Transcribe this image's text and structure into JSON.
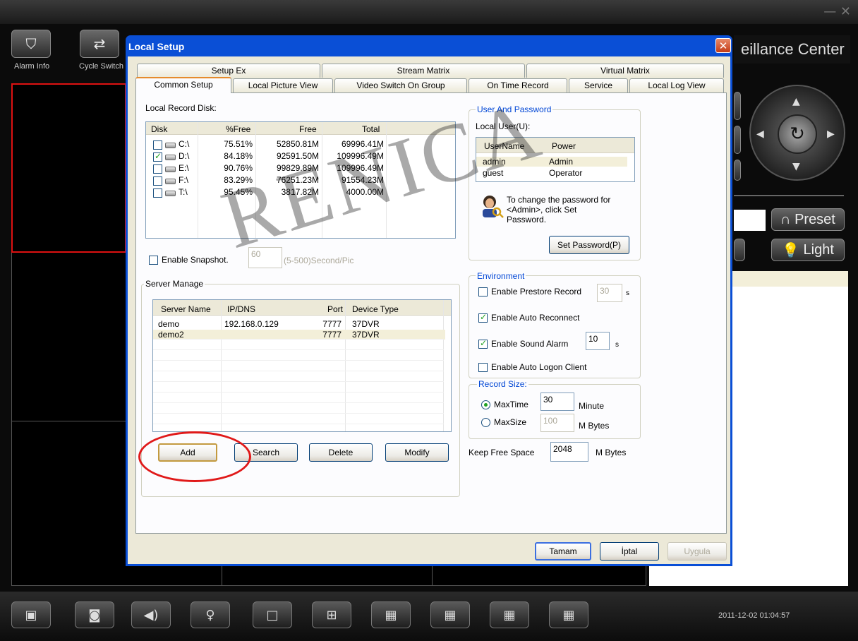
{
  "app": {
    "brand": "eillance Center",
    "window_controls": "— ✕",
    "toolbar": {
      "alarm_info": "Alarm Info",
      "cycle_switch": "Cycle Switch"
    },
    "ptz": {
      "preset_label": "Preset",
      "light_label": "Light"
    },
    "clock": "2011-12-02 01:04:57"
  },
  "dialog": {
    "title": "Local Setup",
    "tabs_row1": [
      "Setup Ex",
      "Stream Matrix",
      "Virtual Matrix"
    ],
    "tabs_row2": [
      "Common Setup",
      "Local Picture View",
      "Video Switch On Group",
      "On Time Record",
      "Service",
      "Local Log View"
    ],
    "local_record_disk": {
      "label": "Local Record Disk:",
      "columns": [
        "Disk",
        "%Free",
        "Free",
        "Total"
      ],
      "rows": [
        {
          "checked": false,
          "disk": "C:\\",
          "pfree": "75.51%",
          "free": "52850.81M",
          "total": "69996.41M"
        },
        {
          "checked": true,
          "disk": "D:\\",
          "pfree": "84.18%",
          "free": "92591.50M",
          "total": "109996.49M"
        },
        {
          "checked": false,
          "disk": "E:\\",
          "pfree": "90.76%",
          "free": "99829.89M",
          "total": "109996.49M"
        },
        {
          "checked": false,
          "disk": "F:\\",
          "pfree": "83.29%",
          "free": "76251.23M",
          "total": "91554.23M"
        },
        {
          "checked": false,
          "disk": "T:\\",
          "pfree": "95.45%",
          "free": "3817.82M",
          "total": "4000.00M"
        }
      ]
    },
    "snapshot": {
      "label": "Enable Snapshot.",
      "value": "60",
      "hint": "(5-500)Second/Pic"
    },
    "server_manage": {
      "legend": "Server Manage",
      "columns": [
        "Server Name",
        "IP/DNS",
        "Port",
        "Device Type"
      ],
      "rows": [
        {
          "name": "demo",
          "ip": "192.168.0.129",
          "port": "7777",
          "type": "37DVR"
        },
        {
          "name": "demo2",
          "ip": "",
          "port": "7777",
          "type": "37DVR"
        }
      ],
      "buttons": {
        "add": "Add",
        "search": "Search",
        "delete": "Delete",
        "modify": "Modify"
      }
    },
    "user_password": {
      "legend": "User And Password",
      "local_user": "Local User(U):",
      "columns": [
        "UserName",
        "Power"
      ],
      "rows": [
        {
          "name": "admin",
          "power": "Admin"
        },
        {
          "name": "guest",
          "power": "Operator"
        }
      ],
      "hint_line1": "To change the password for",
      "hint_line2": "<Admin>, click Set",
      "hint_line3": "Password.",
      "set_password": "Set Password(P)"
    },
    "environment": {
      "legend": "Environment",
      "prestore": {
        "label": "Enable Prestore Record",
        "checked": false,
        "value": "30",
        "unit": "s"
      },
      "auto_reconnect": {
        "label": "Enable Auto Reconnect",
        "checked": true
      },
      "sound_alarm": {
        "label": "Enable Sound Alarm",
        "checked": true,
        "value": "10",
        "unit": "s"
      },
      "auto_logon": {
        "label": "Enable Auto Logon Client",
        "checked": false
      }
    },
    "record_size": {
      "legend": "Record Size:",
      "maxtime": {
        "label": "MaxTime",
        "value": "30",
        "unit": "Minute",
        "selected": true
      },
      "maxsize": {
        "label": "MaxSize",
        "value": "100",
        "unit": "M Bytes",
        "selected": false
      }
    },
    "keep_free": {
      "label": "Keep Free Space",
      "value": "2048",
      "unit": "M Bytes"
    },
    "footer": {
      "ok": "Tamam",
      "cancel": "İptal",
      "apply": "Uygula"
    }
  },
  "watermark": "RENICA"
}
